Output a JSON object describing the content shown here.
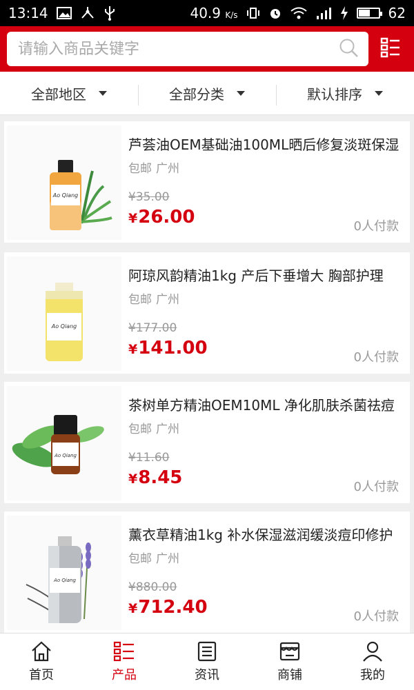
{
  "status_bar": {
    "time": "13:14",
    "speed": "40.9",
    "speed_unit": "K/s",
    "battery": "62"
  },
  "search": {
    "placeholder": "请输入商品关键字"
  },
  "filters": [
    {
      "label": "全部地区"
    },
    {
      "label": "全部分类"
    },
    {
      "label": "默认排序"
    }
  ],
  "products": [
    {
      "title": "芦荟油OEM基础油100ML晒后修复淡斑保湿",
      "shipping": "包邮",
      "location": "广州",
      "old_price": "¥35.00",
      "currency": "¥",
      "price": "26.00",
      "paid": "0人付款",
      "image": "aloe-oil-bottle"
    },
    {
      "title": "阿琼风韵精油1kg 产后下垂增大 胸部护理",
      "shipping": "包邮",
      "location": "广州",
      "old_price": "¥177.00",
      "currency": "¥",
      "price": "141.00",
      "paid": "0人付款",
      "image": "breast-oil-bottle"
    },
    {
      "title": "茶树单方精油OEM10ML 净化肌肤杀菌祛痘",
      "shipping": "包邮",
      "location": "广州",
      "old_price": "¥11.60",
      "currency": "¥",
      "price": "8.45",
      "paid": "0人付款",
      "image": "tea-tree-oil-bottle"
    },
    {
      "title": "薰衣草精油1kg 补水保湿滋润缓淡痘印修护",
      "shipping": "包邮",
      "location": "广州",
      "old_price": "¥880.00",
      "currency": "¥",
      "price": "712.40",
      "paid": "0人付款",
      "image": "lavender-oil-bottle"
    }
  ],
  "bottom_nav": [
    {
      "label": "首页",
      "icon": "home-icon",
      "active": false
    },
    {
      "label": "产品",
      "icon": "product-list-icon",
      "active": true
    },
    {
      "label": "资讯",
      "icon": "news-icon",
      "active": false
    },
    {
      "label": "商铺",
      "icon": "shop-icon",
      "active": false
    },
    {
      "label": "我的",
      "icon": "user-icon",
      "active": false
    }
  ],
  "colors": {
    "brand": "#d4000f",
    "background": "#efefef",
    "muted_text": "#999999"
  }
}
